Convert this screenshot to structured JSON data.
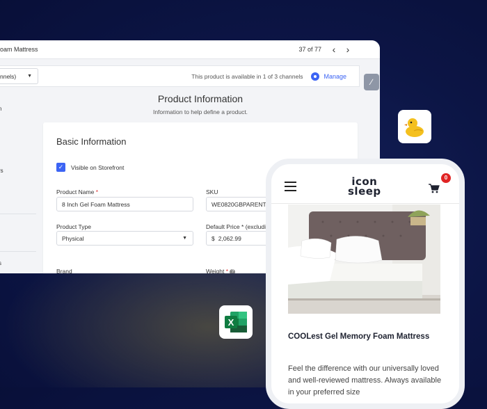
{
  "admin": {
    "product_title": "oam Mattress",
    "pagination": "37 of 77",
    "channel_select": "nnels)",
    "channel_status": "This product is available in 1 of 3 channels",
    "manage_label": "Manage",
    "sidebar_fragments": [
      "n",
      "rs",
      "s"
    ],
    "section_title": "Product Information",
    "section_subtitle": "Information to help define a product.",
    "card": {
      "heading": "Basic Information",
      "visible_label": "Visible on Storefront",
      "product_name_label": "Product Name",
      "product_name_value": "8 Inch Gel Foam Mattress",
      "sku_label": "SKU",
      "sku_value": "WE0820GBPARENT",
      "product_type_label": "Product Type",
      "product_type_value": "Physical",
      "default_price_label": "Default Price * (excludi",
      "currency_symbol": "$",
      "default_price_value": "2,062.99",
      "brand_label": "Brand",
      "weight_label": "Weight"
    }
  },
  "phone": {
    "logo_line1": "icon",
    "logo_line2": "sleep",
    "cart_count": "0",
    "product_title": "COOLest Gel Memory Foam Mattress",
    "product_desc": "Feel the difference with our universally loved and well-reviewed mattress. Always available in your preferred size"
  },
  "icons": {
    "excel_letter": "X"
  }
}
